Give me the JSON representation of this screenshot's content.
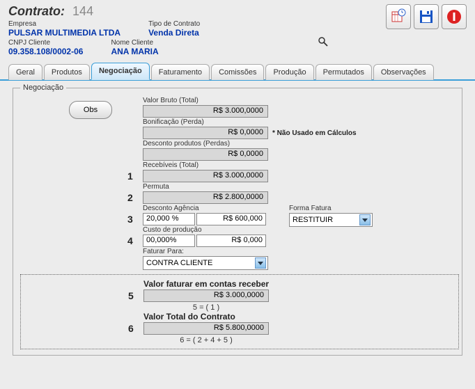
{
  "header": {
    "contract_label": "Contrato:",
    "contract_number": "144",
    "empresa_label": "Empresa",
    "empresa_value": "PULSAR MULTIMEDIA LTDA",
    "tipo_label": "Tipo de Contrato",
    "tipo_value": "Venda Direta",
    "cnpj_label": "CNPJ Cliente",
    "cnpj_value": "09.358.108/0002-06",
    "nome_label": "Nome Cliente",
    "nome_value": "ANA MARIA"
  },
  "tabs": {
    "geral": "Geral",
    "produtos": "Produtos",
    "negociacao": "Negociação",
    "faturamento": "Faturamento",
    "comissoes": "Comissões",
    "producao": "Produção",
    "permutados": "Permutados",
    "observacoes": "Observações"
  },
  "negociacao": {
    "legend": "Negociação",
    "obs_btn": "Obs",
    "labels": {
      "valor_bruto": "Valor Bruto (Total)",
      "bonificacao": "Bonificação (Perda)",
      "desconto_produtos": "Desconto produtos (Perdas)",
      "recebiveis": "Recebíveis (Total)",
      "permuta": "Permuta",
      "desconto_agencia": "Desconto Agência",
      "forma_fatura": "Forma Fatura",
      "custo_producao": "Custo de produção",
      "faturar_para": "Faturar Para:",
      "valor_faturar": "Valor faturar em contas receber",
      "valor_total": "Valor Total do Contrato"
    },
    "values": {
      "valor_bruto": "R$ 3.000,0000",
      "bonificacao": "R$ 0,0000",
      "desconto_produtos": "R$ 0,0000",
      "recebiveis": "R$ 3.000,0000",
      "permuta": "R$ 2.800,0000",
      "desc_ag_pct": "20,000 %",
      "desc_ag_val": "R$ 600,000",
      "custo_pct": "00,000%",
      "custo_val": "R$ 0,000",
      "forma_fatura": "RESTITUIR",
      "faturar_para": "CONTRA CLIENTE",
      "valor_faturar": "R$ 3.000,0000",
      "valor_total": "R$ 5.800,0000"
    },
    "note_bonif": "* Não Usado em Cálculos",
    "nums": {
      "n1": "1",
      "n2": "2",
      "n3": "3",
      "n4": "4",
      "n5": "5",
      "n6": "6"
    },
    "formulas": {
      "f5": "5 = ( 1 )",
      "f6": "6 = ( 2 + 4 + 5 )"
    }
  }
}
